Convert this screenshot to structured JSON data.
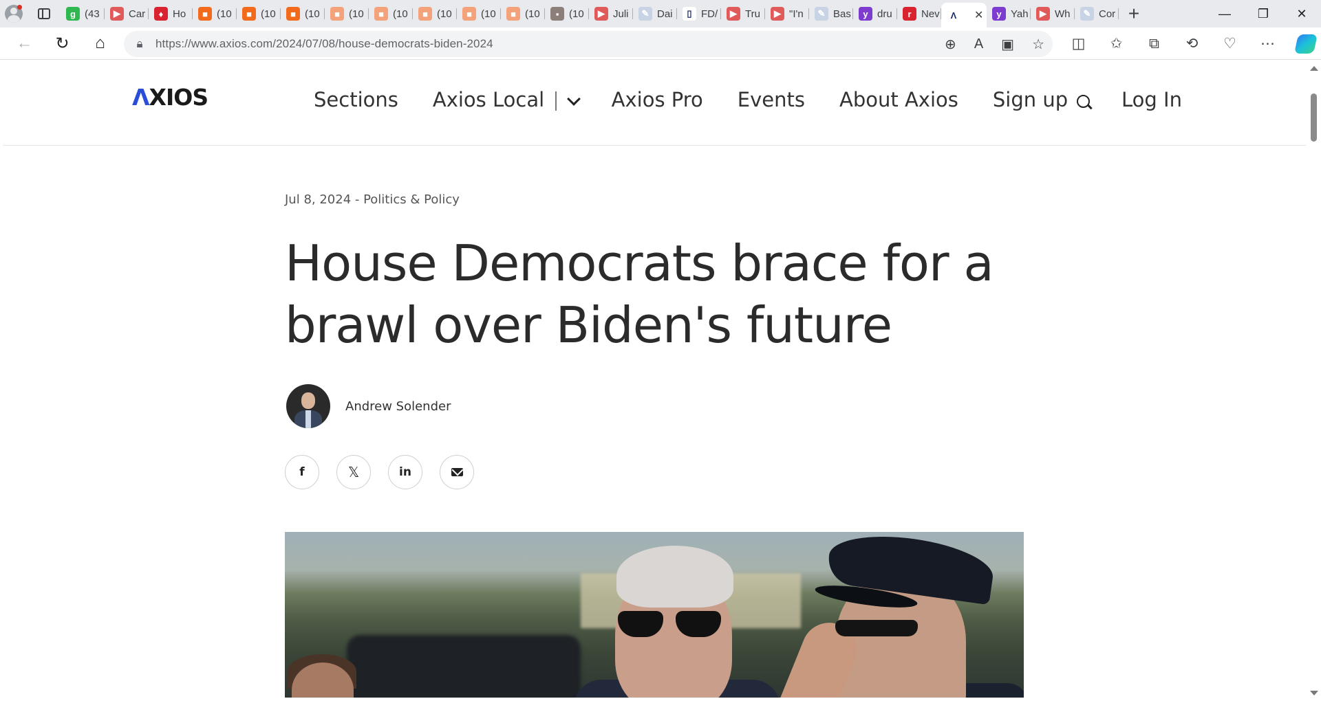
{
  "browser": {
    "tabs": [
      {
        "label": "(43",
        "fav_color": "#2fb84f",
        "fav_glyph": "g"
      },
      {
        "label": "Car",
        "fav_color": "#e05a5a",
        "fav_glyph": "▶"
      },
      {
        "label": "Ho",
        "fav_color": "#d92330",
        "fav_glyph": "♦"
      },
      {
        "label": "(10",
        "fav_color": "#f26b1d",
        "fav_glyph": "■"
      },
      {
        "label": "(10",
        "fav_color": "#f26b1d",
        "fav_glyph": "■"
      },
      {
        "label": "(10",
        "fav_color": "#f26b1d",
        "fav_glyph": "■"
      },
      {
        "label": "(10",
        "fav_color": "#f3a27a",
        "fav_glyph": "■"
      },
      {
        "label": "(10",
        "fav_color": "#f3a27a",
        "fav_glyph": "■"
      },
      {
        "label": "(10",
        "fav_color": "#f3a27a",
        "fav_glyph": "■"
      },
      {
        "label": "(10",
        "fav_color": "#f3a27a",
        "fav_glyph": "■"
      },
      {
        "label": "(10",
        "fav_color": "#f3a27a",
        "fav_glyph": "■"
      },
      {
        "label": "(10",
        "fav_color": "#8c7e78",
        "fav_glyph": "▪"
      },
      {
        "label": "Juli",
        "fav_color": "#e05a5a",
        "fav_glyph": "▶"
      },
      {
        "label": "Dai",
        "fav_color": "#c9d3e6",
        "fav_glyph": "✎"
      },
      {
        "label": "FD/",
        "fav_color": "#ffffff",
        "fav_glyph": "▯"
      },
      {
        "label": "Tru",
        "fav_color": "#e05a5a",
        "fav_glyph": "▶"
      },
      {
        "label": "\"I'n",
        "fav_color": "#e05a5a",
        "fav_glyph": "▶"
      },
      {
        "label": "Bas",
        "fav_color": "#c9d3e6",
        "fav_glyph": "✎"
      },
      {
        "label": "dru",
        "fav_color": "#7e3bd0",
        "fav_glyph": "y"
      },
      {
        "label": "Nev",
        "fav_color": "#d9232e",
        "fav_glyph": "r"
      },
      {
        "label": "",
        "fav_color": "#ffffff",
        "fav_glyph": "Λ",
        "active": true
      },
      {
        "label": "Yah",
        "fav_color": "#7e3bd0",
        "fav_glyph": "y"
      },
      {
        "label": "Wh",
        "fav_color": "#e05a5a",
        "fav_glyph": "▶"
      },
      {
        "label": "Cor",
        "fav_color": "#c9d3e6",
        "fav_glyph": "✎"
      }
    ],
    "active_tab_close": "✕",
    "new_tab": "+",
    "window_minimize": "—",
    "window_restore": "❐",
    "window_close": "✕",
    "url_host": "https://www.axios.com",
    "url_path": "/2024/07/08/house-democrats-biden-2024"
  },
  "site": {
    "logo_a": "Λ",
    "logo_rest": "XIOS",
    "nav": {
      "sections": "Sections",
      "local": "Axios Local",
      "pro": "Axios Pro",
      "events": "Events",
      "about": "About Axios",
      "signup": "Sign up",
      "login": "Log In"
    }
  },
  "article": {
    "meta": "Jul 8, 2024 - Politics & Policy",
    "headline": "House Democrats brace for a brawl over Biden's future",
    "author": "Andrew Solender",
    "share": {
      "facebook": "f",
      "x": "𝕏",
      "linkedin": "in"
    }
  }
}
